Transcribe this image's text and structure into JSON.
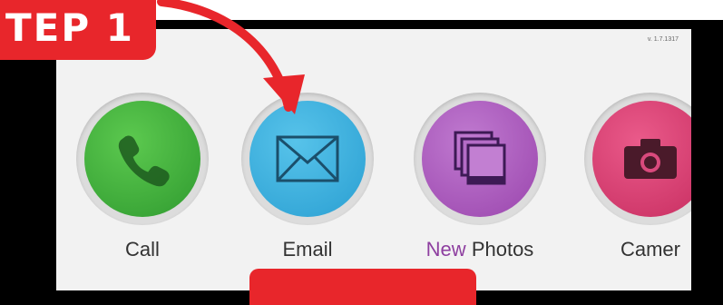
{
  "step_badge": {
    "text": "TEP 1"
  },
  "version": "v. 1.7.1317",
  "apps": [
    {
      "label": "Call",
      "icon": "phone-icon",
      "color": "#3fae3c"
    },
    {
      "label": "Email",
      "icon": "envelope-icon",
      "color": "#3aaee0"
    },
    {
      "label_accent": "New",
      "label": "Photos",
      "icon": "photos-icon",
      "color": "#a653b8"
    },
    {
      "label": "Camer",
      "icon": "camera-icon",
      "color": "#d93a73"
    }
  ],
  "colors": {
    "accent_red": "#e8262b",
    "screen_bg": "#f2f2f2"
  }
}
